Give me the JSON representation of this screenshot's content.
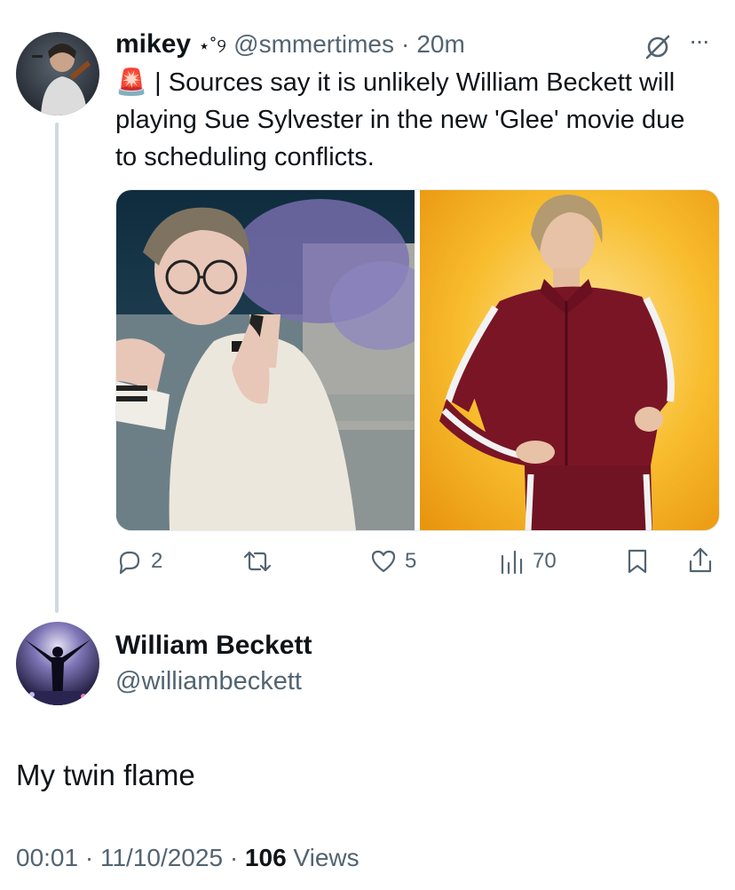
{
  "tweet": {
    "author_name": "mikey",
    "author_deco": "⋆˚୨",
    "handle": "@smmertimes",
    "separator": "·",
    "time": "20m",
    "alert_emoji": "🚨",
    "text": "| Sources say it is unlikely William Beckett will playing Sue Sylvester in the new 'Glee' movie due to scheduling conflicts.",
    "more_label": "···",
    "actions": {
      "replies": "2",
      "reposts": "",
      "likes": "5",
      "views": "70"
    }
  },
  "reply": {
    "author_name": "William Beckett",
    "handle": "@williambeckett",
    "text": "My twin flame",
    "time": "00:01",
    "date": "11/10/2025",
    "separator": "·",
    "views_count": "106",
    "views_label": "Views"
  },
  "colors": {
    "muted": "#536471",
    "text": "#0f1419",
    "thread_line": "#cfd9de",
    "tracksuit": "#7a1526",
    "yellow_bg": "#f6b21b"
  },
  "icons": [
    "no-notifications-icon",
    "more-icon",
    "reply-icon",
    "repost-icon",
    "like-icon",
    "views-icon",
    "bookmark-icon",
    "share-icon"
  ]
}
